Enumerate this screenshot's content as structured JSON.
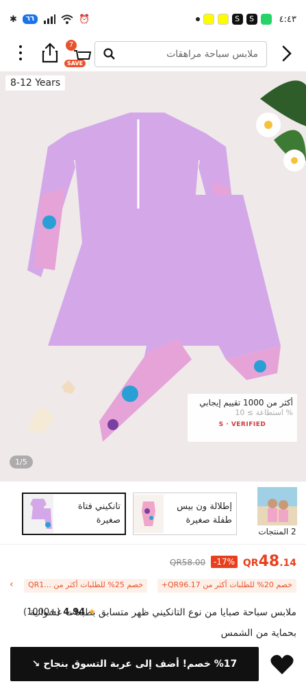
{
  "status_bar": {
    "time": "٤:٤٣",
    "network_label": "٦٦"
  },
  "header": {
    "search_placeholder": "ملابس سباحة مراهقات",
    "cart_count": "7",
    "save_label": "SAVE"
  },
  "hero": {
    "age_tag": "8-12 Years",
    "image_counter": "1/5",
    "rating_line1": "أكثر من 1000 تقييم إيجابي",
    "rating_line2": "% استطاعة ≥ 10",
    "verified_label": "S · VERIFIED"
  },
  "thumbnails": {
    "items": [
      {
        "label": "تانكيني فتاة صغيرة"
      },
      {
        "label": "إطلالة ون بيس طفلة صغيرة"
      }
    ],
    "all_products_label": "2 المنتجات"
  },
  "price": {
    "current_currency": "QR",
    "current_integer": "48",
    "current_decimal": ".14",
    "discount": "-17%",
    "original": "QR58.00"
  },
  "promotions": [
    "خصم 20% للطلبات أكثر من QR96.17+",
    "خصم 25% للطلبات أكثر من ...QR1"
  ],
  "product": {
    "title": "ملابس سباحة صبايا من نوع التانكيني ظهر متسابق بطبعات عشوائية بحماية من الشمس",
    "rating_value": "4.94",
    "review_count": "(1000+)"
  },
  "bottom_bar": {
    "add_to_cart_label": "%17 خصم! أضف إلى عربة التسوق بنجاح ↘"
  },
  "colors": {
    "accent": "#e8401c",
    "primary_dark": "#111111",
    "lavender": "#d4a8e8"
  }
}
